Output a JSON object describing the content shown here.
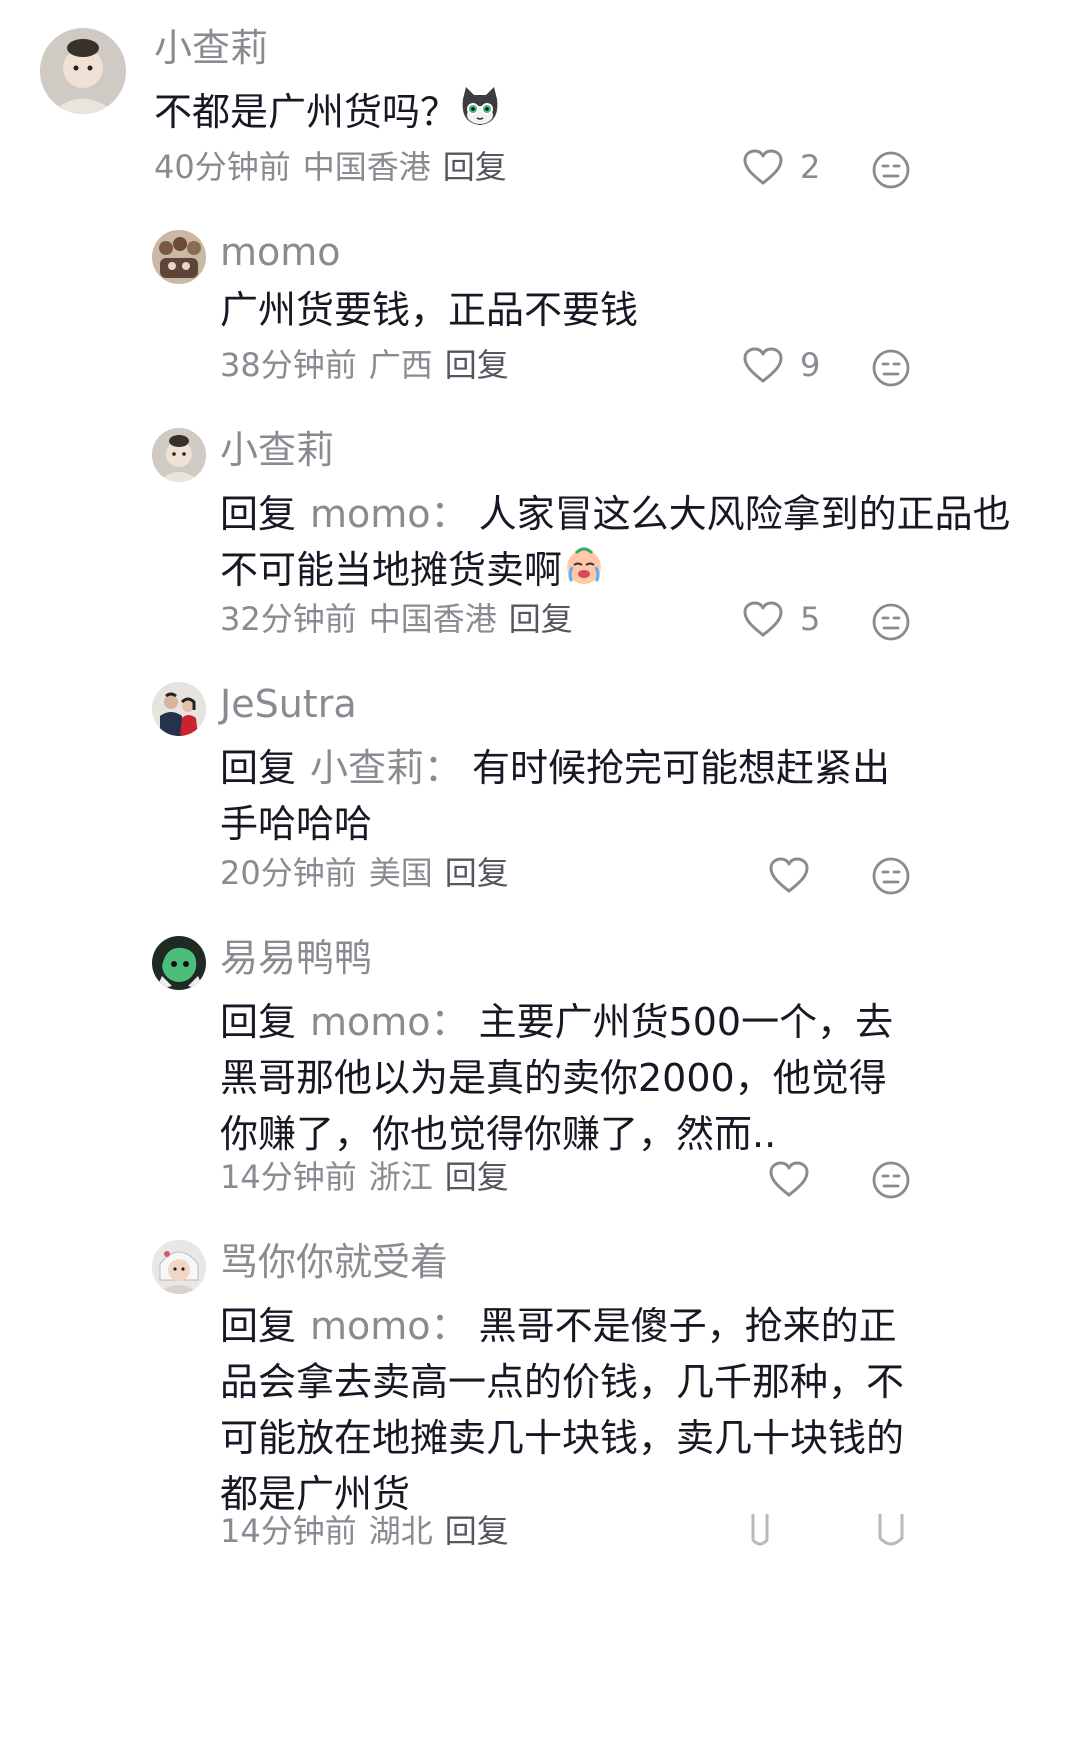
{
  "comments": [
    {
      "username": "小查莉",
      "text": "不都是广州货吗？",
      "emoji": "cat-emoji",
      "time": "40分钟前",
      "location": "中国香港",
      "reply_label": "回复",
      "likes": "2"
    },
    {
      "username": "momo",
      "text": "广州货要钱，正品不要钱",
      "time": "38分钟前",
      "location": "广西",
      "reply_label": "回复",
      "likes": "9"
    },
    {
      "username": "小查莉",
      "reply_prefix": "回复",
      "reply_target": "momo",
      "colon": "：",
      "text": "人家冒这么大风险拿到的正品也不可能当地摊货卖啊",
      "emoji": "crying-emoji",
      "time": "32分钟前",
      "location": "中国香港",
      "reply_label": "回复",
      "likes": "5"
    },
    {
      "username": "JeSutra",
      "reply_prefix": "回复",
      "reply_target": "小查莉",
      "colon": "：",
      "text": "有时候抢完可能想赶紧出手哈哈哈",
      "time": "20分钟前",
      "location": "美国",
      "reply_label": "回复",
      "likes": ""
    },
    {
      "username": "易易鸭鸭",
      "reply_prefix": "回复",
      "reply_target": "momo",
      "colon": "：",
      "text": "主要广州货500一个，去黑哥那他以为是真的卖你2000，他觉得你赚了，你也觉得你赚了，然而..",
      "time": "14分钟前",
      "location": "浙江",
      "reply_label": "回复",
      "likes": ""
    },
    {
      "username": "骂你你就受着",
      "reply_prefix": "回复",
      "reply_target": "momo",
      "colon": "：",
      "text": "黑哥不是傻子，抢来的正品会拿去卖高一点的价钱，几千那种，不可能放在地摊卖几十块钱，卖几十块钱的都是广州货",
      "time": "14分钟前",
      "location": "湖北",
      "reply_label": "回复",
      "likes": ""
    }
  ],
  "colors": {
    "muted": "#8a8b91",
    "text": "#161823"
  }
}
